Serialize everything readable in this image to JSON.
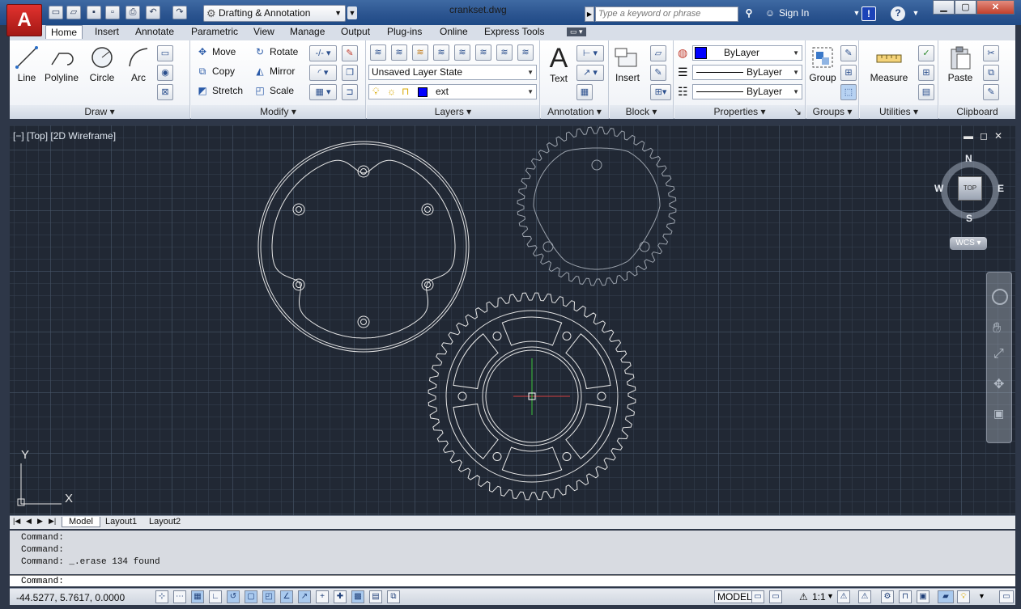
{
  "app": {
    "file_title": "crankset.dwg",
    "workspace": "Drafting & Annotation",
    "search_placeholder": "Type a keyword or phrase",
    "sign_in": "Sign In",
    "logo_letter": "A"
  },
  "ribbon_tabs": [
    "Home",
    "Insert",
    "Annotate",
    "Parametric",
    "View",
    "Manage",
    "Output",
    "Plug-ins",
    "Online",
    "Express Tools"
  ],
  "draw": {
    "line": "Line",
    "polyline": "Polyline",
    "circle": "Circle",
    "arc": "Arc",
    "panel": "Draw"
  },
  "modify": {
    "move": "Move",
    "copy": "Copy",
    "stretch": "Stretch",
    "rotate": "Rotate",
    "mirror": "Mirror",
    "scale": "Scale",
    "panel": "Modify"
  },
  "layers": {
    "state": "Unsaved Layer State",
    "current": "ext",
    "panel": "Layers"
  },
  "annotation": {
    "text": "Text",
    "panel": "Annotation"
  },
  "block": {
    "insert": "Insert",
    "panel": "Block"
  },
  "properties": {
    "color": "ByLayer",
    "linetype": "ByLayer",
    "lineweight": "ByLayer",
    "panel": "Properties"
  },
  "groups": {
    "group": "Group",
    "panel": "Groups"
  },
  "utilities": {
    "measure": "Measure",
    "panel": "Utilities"
  },
  "clipboard": {
    "paste": "Paste",
    "panel": "Clipboard"
  },
  "viewport": {
    "label": "[−] [Top] [2D Wireframe]",
    "compass": {
      "n": "N",
      "s": "S",
      "e": "E",
      "w": "W",
      "top": "TOP"
    },
    "wcs": "WCS",
    "ucs_x": "X",
    "ucs_y": "Y"
  },
  "layout_tabs": [
    "Model",
    "Layout1",
    "Layout2"
  ],
  "command": {
    "history": [
      "Command:",
      "Command:",
      "Command: _.erase 134 found"
    ],
    "prompt": "Command:"
  },
  "status": {
    "coords": "-44.5277, 5.7617, 0.0000",
    "model": "MODEL",
    "scale": "1:1"
  },
  "colors": {
    "accent": "#2c5590",
    "viewport_bg": "#212834",
    "crosshair_x": "#d24040",
    "crosshair_y": "#3cc43c"
  }
}
